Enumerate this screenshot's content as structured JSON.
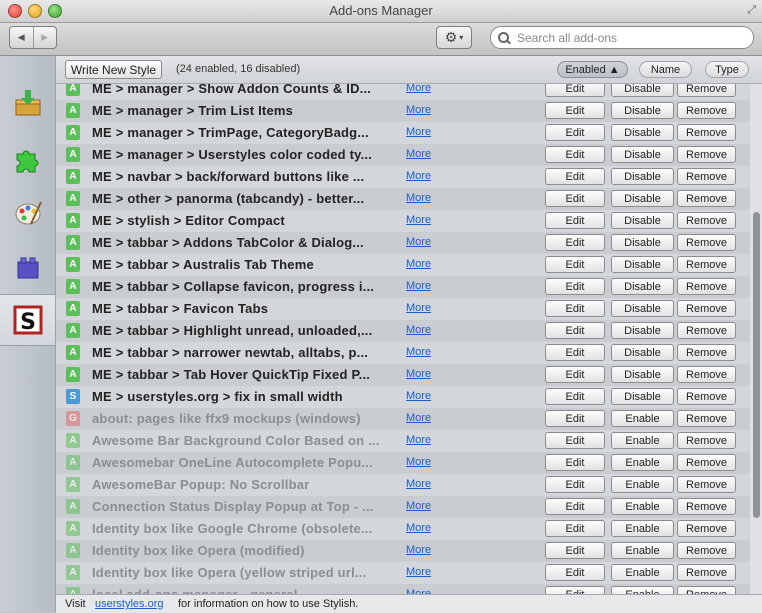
{
  "window": {
    "title": "Add-ons Manager"
  },
  "search": {
    "placeholder": "Search all add-ons"
  },
  "sidebar": {
    "categories": [
      {
        "name": "get-addons",
        "icon": "download-box-icon"
      },
      {
        "name": "extensions",
        "icon": "puzzle-icon"
      },
      {
        "name": "appearance",
        "icon": "palette-icon"
      },
      {
        "name": "plugins",
        "icon": "lego-block-icon"
      },
      {
        "name": "user-styles",
        "icon": "stylish-s-icon",
        "selected": true
      }
    ]
  },
  "list_header": {
    "write_button": "Write New Style",
    "counts": "(24 enabled, 16 disabled)",
    "sort_enabled": "Enabled ▲",
    "sort_name": "Name",
    "sort_type": "Type"
  },
  "row_labels": {
    "more": "More",
    "edit": "Edit",
    "disable": "Disable",
    "enable": "Enable",
    "remove": "Remove"
  },
  "colors": {
    "badge_green": "#5cc05a",
    "badge_blue": "#4a9ad8",
    "badge_red": "#e06c6c",
    "link": "#1b5fc7"
  },
  "styles": [
    {
      "badge": "A",
      "name": "ME > manager > Show Addon Counts & ID...",
      "enabled": true
    },
    {
      "badge": "A",
      "name": "ME > manager > Trim List Items",
      "enabled": true
    },
    {
      "badge": "A",
      "name": "ME > manager > TrimPage, CategoryBadg...",
      "enabled": true
    },
    {
      "badge": "A",
      "name": "ME > manager > Userstyles color coded ty...",
      "enabled": true
    },
    {
      "badge": "A",
      "name": "ME > navbar > back/forward buttons like ...",
      "enabled": true
    },
    {
      "badge": "A",
      "name": "ME > other > panorma (tabcandy) - better...",
      "enabled": true
    },
    {
      "badge": "A",
      "name": "ME > stylish > Editor Compact",
      "enabled": true
    },
    {
      "badge": "A",
      "name": "ME > tabbar > Addons TabColor & Dialog...",
      "enabled": true
    },
    {
      "badge": "A",
      "name": "ME > tabbar > Australis Tab Theme",
      "enabled": true
    },
    {
      "badge": "A",
      "name": "ME > tabbar > Collapse favicon, progress i...",
      "enabled": true
    },
    {
      "badge": "A",
      "name": "ME > tabbar > Favicon Tabs",
      "enabled": true
    },
    {
      "badge": "A",
      "name": "ME > tabbar > Highlight unread, unloaded,...",
      "enabled": true
    },
    {
      "badge": "A",
      "name": "ME > tabbar > narrower newtab, alltabs, p...",
      "enabled": true
    },
    {
      "badge": "A",
      "name": "ME > tabbar > Tab Hover QuickTip Fixed P...",
      "enabled": true
    },
    {
      "badge": "S",
      "name": "ME > userstyles.org > fix in small width",
      "enabled": true
    },
    {
      "badge": "G",
      "name": "about: pages like ffx9 mockups (windows)",
      "enabled": false
    },
    {
      "badge": "A",
      "name": "Awesome Bar Background Color Based on ...",
      "enabled": false
    },
    {
      "badge": "A",
      "name": "Awesomebar OneLine Autocomplete Popu...",
      "enabled": false
    },
    {
      "badge": "A",
      "name": "AwesomeBar Popup: No Scrollbar",
      "enabled": false
    },
    {
      "badge": "A",
      "name": "Connection Status Display Popup at Top - ...",
      "enabled": false
    },
    {
      "badge": "A",
      "name": "Identity box like Google Chrome (obsolete...",
      "enabled": false
    },
    {
      "badge": "A",
      "name": "Identity box like Opera (modified)",
      "enabled": false
    },
    {
      "badge": "A",
      "name": "Identity box like Opera (yellow striped url...",
      "enabled": false
    },
    {
      "badge": "A",
      "name": "local add-ons manager - general",
      "enabled": false
    }
  ],
  "footer": {
    "prefix": "Visit",
    "link": "userstyles.org",
    "suffix": "for information on how to use Stylish."
  }
}
